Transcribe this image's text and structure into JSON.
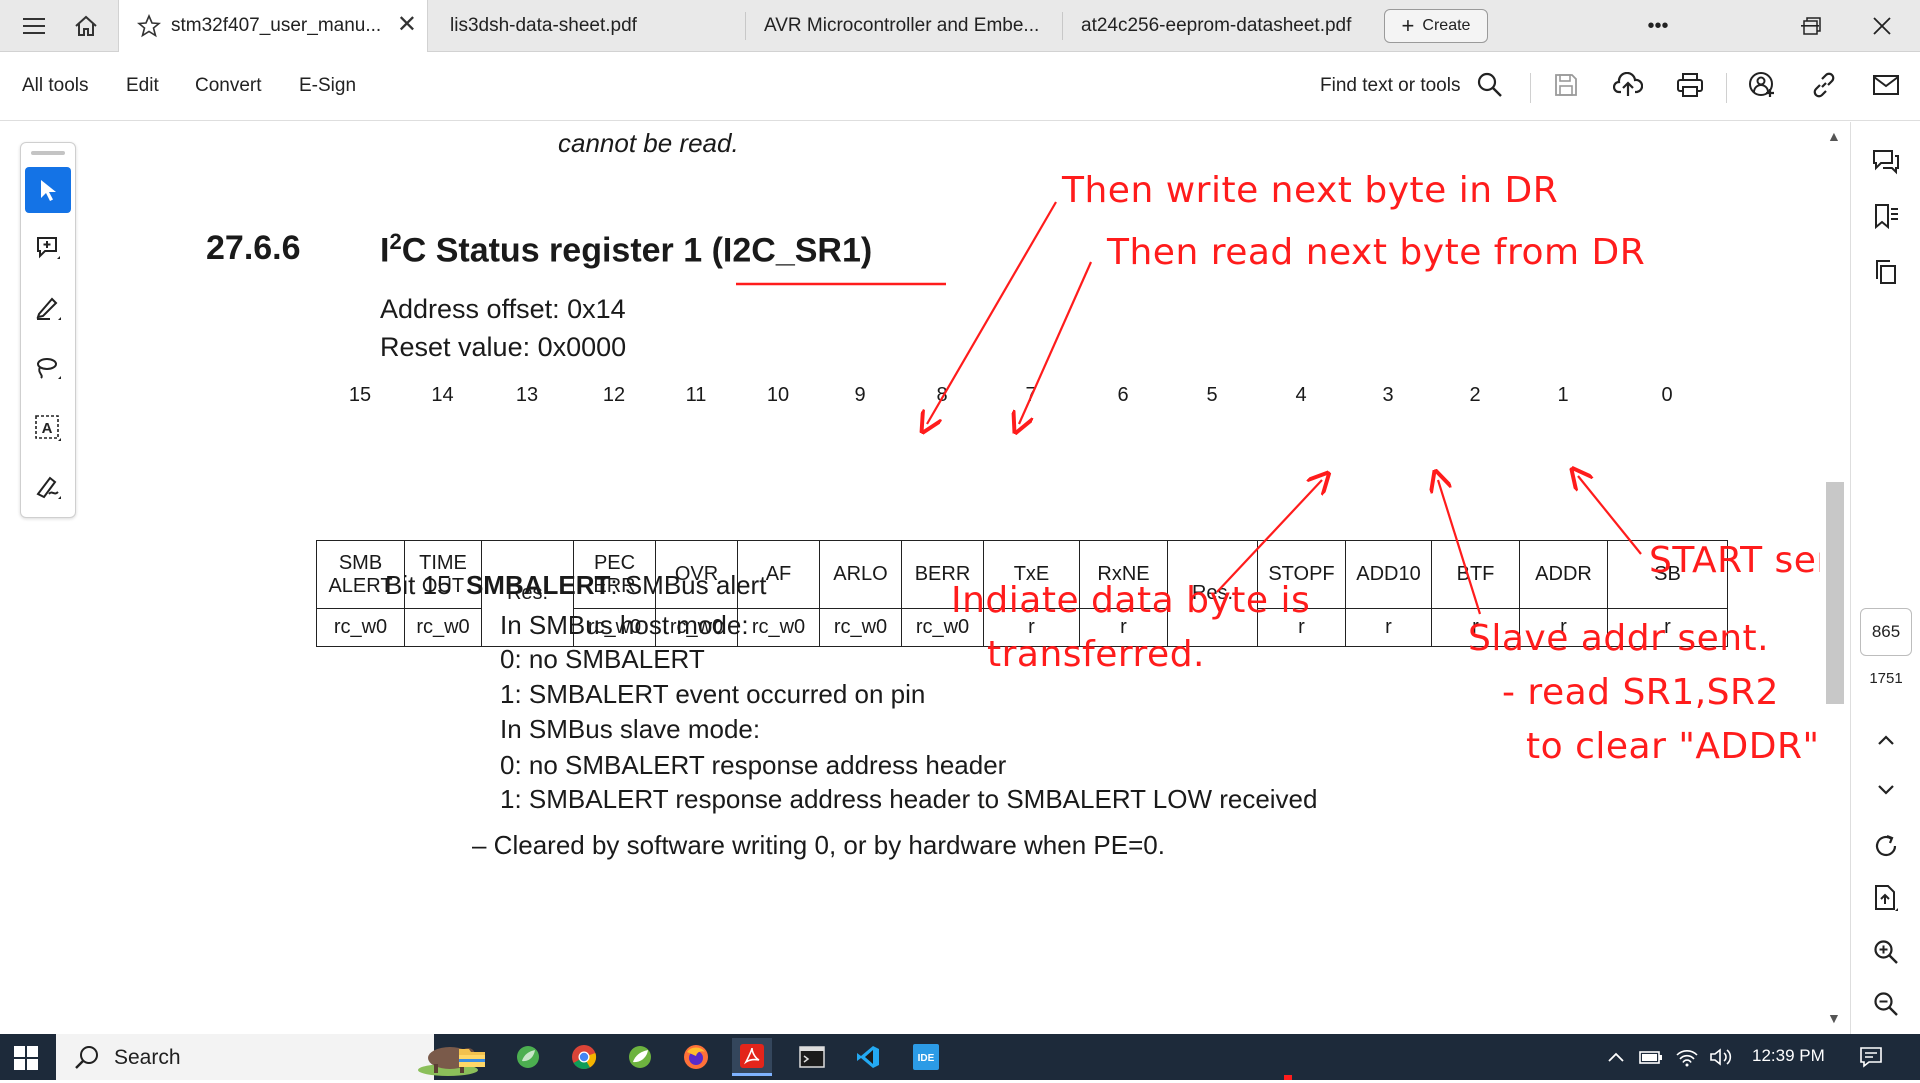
{
  "tabs": [
    {
      "label": "stm32f407_user_manu...",
      "active": true
    },
    {
      "label": "lis3dsh-data-sheet.pdf"
    },
    {
      "label": "AVR Microcontroller and Embe..."
    },
    {
      "label": "at24c256-eeprom-datasheet.pdf"
    }
  ],
  "create_label": "Create",
  "menu": {
    "all_tools": "All tools",
    "edit": "Edit",
    "convert": "Convert",
    "esign": "E-Sign",
    "find": "Find text or tools"
  },
  "document": {
    "top_text": "cannot be read.",
    "section_number": "27.6.6",
    "section_title_pre": "I",
    "section_title_sup": "2",
    "section_title_post": "C Status register 1 (I2C_SR1)",
    "address_offset": "Address offset: 0x14",
    "reset_value": "Reset value: 0x0000",
    "bit_numbers": [
      "15",
      "14",
      "13",
      "12",
      "11",
      "10",
      "9",
      "8",
      "7",
      "6",
      "5",
      "4",
      "3",
      "2",
      "1",
      "0"
    ],
    "register_fields": [
      {
        "name": "SMB\nALERT",
        "access": "rc_w0"
      },
      {
        "name": "TIME\nOUT",
        "access": "rc_w0"
      },
      {
        "name": "Res.",
        "access": ""
      },
      {
        "name": "PEC\nERR",
        "access": "rc_w0"
      },
      {
        "name": "OVR",
        "access": "rc_w0"
      },
      {
        "name": "AF",
        "access": "rc_w0"
      },
      {
        "name": "ARLO",
        "access": "rc_w0"
      },
      {
        "name": "BERR",
        "access": "rc_w0"
      },
      {
        "name": "TxE",
        "access": "r"
      },
      {
        "name": "RxNE",
        "access": "r"
      },
      {
        "name": "Res.",
        "access": ""
      },
      {
        "name": "STOPF",
        "access": "r"
      },
      {
        "name": "ADD10",
        "access": "r"
      },
      {
        "name": "BTF",
        "access": "r"
      },
      {
        "name": "ADDR",
        "access": "r"
      },
      {
        "name": "SB",
        "access": "r"
      }
    ],
    "bit15_label": "Bit 15",
    "bit15_name": "SMBALERT",
    "bit15_desc": ": SMBus alert",
    "desc_lines": [
      "In SMBus host mode:",
      "0: no SMBALERT",
      "1: SMBALERT event occurred on pin",
      "In SMBus slave mode:",
      "0: no SMBALERT response address header",
      "1: SMBALERT response address header to SMBALERT LOW received"
    ],
    "cleared_line": "–  Cleared by software writing 0, or by hardware when PE=0."
  },
  "annotations": {
    "txe": "Then write next byte in DR",
    "rxne": "Then read next byte from DR",
    "btf_1": "Indiate data byte is",
    "btf_2": "transferred.",
    "addr_1": "Slave addr sent.",
    "addr_2": "- read SR1,SR2",
    "addr_3": "to clear \"ADDR\"",
    "sb": "START sent.",
    "color": "#ff1c1c"
  },
  "page": {
    "current": "865",
    "total": "1751"
  },
  "taskbar": {
    "search": "Search",
    "time": "12:39 PM"
  },
  "icons": [
    "hamburger-icon",
    "home-icon",
    "star-icon",
    "close-icon",
    "plus-icon",
    "more-icon",
    "minimize-icon",
    "restore-icon",
    "search-icon",
    "save-icon",
    "upload-icon",
    "print-icon",
    "add-user-icon",
    "link-icon",
    "mail-icon",
    "cursor-icon",
    "comment-icon",
    "pen-icon",
    "lasso-icon",
    "text-select-icon",
    "sign-icon",
    "chat-icon",
    "bookmark-icon",
    "copy-icon",
    "refresh-icon",
    "export-icon",
    "zoom-in-icon",
    "zoom-out-icon"
  ]
}
